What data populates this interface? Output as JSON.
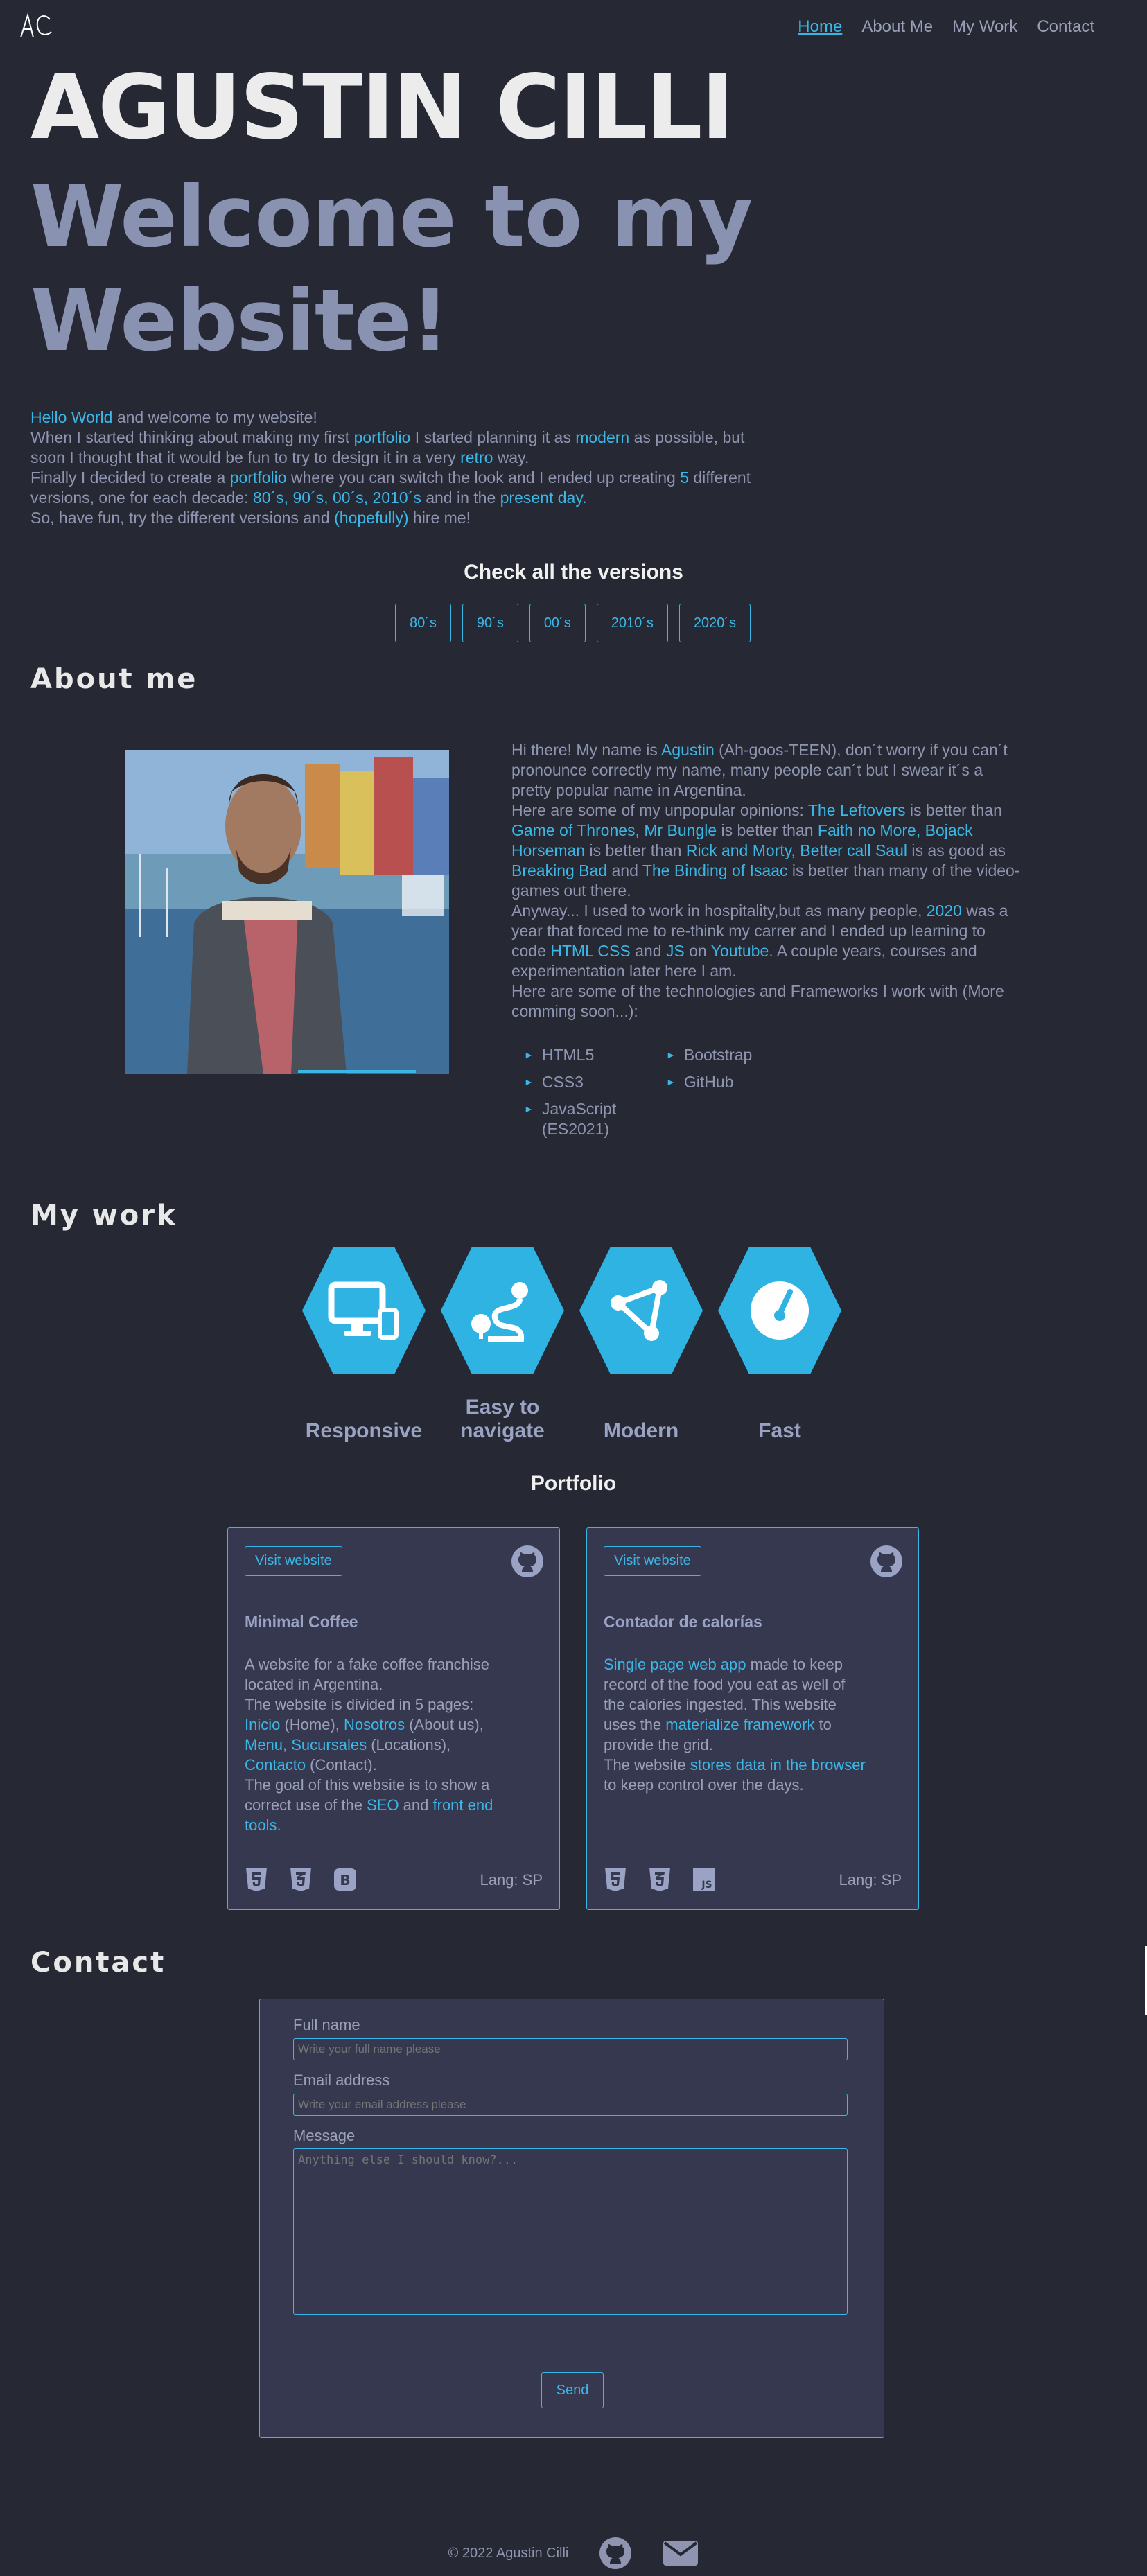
{
  "nav": {
    "logo_text": "AC",
    "items": [
      "Home",
      "About Me",
      "My Work",
      "Contact"
    ]
  },
  "hero": {
    "name": "AGUSTIN CILLI",
    "welcome": "Welcome to my Website!"
  },
  "intro": {
    "l1_a": "Hello World",
    "l1_b": " and welcome to my website!",
    "l2_a": "When I started thinking about making my first ",
    "l2_b": "portfolio",
    "l2_c": " I started planning it as ",
    "l2_d": "modern",
    "l2_e": " as possible, but soon I thought that it would be fun to try to design it in a very ",
    "l2_f": "retro",
    "l2_g": " way.",
    "l3_a": "Finally I decided to create a ",
    "l3_b": "portfolio",
    "l3_c": " where you can switch the look and I ended up creating ",
    "l3_d": "5",
    "l3_e": " different versions, one for each decade: ",
    "l3_f": "80´s, 90´s, 00´s, 2010´s",
    "l3_g": " and in the ",
    "l3_h": "present day.",
    "l4_a": "So, have fun, try the different versions and ",
    "l4_b": "(hopefully)",
    "l4_c": " hire me!"
  },
  "versions": {
    "title": "Check all the versions",
    "buttons": [
      "80´s",
      "90´s",
      "00´s",
      "2010´s",
      "2020´s"
    ]
  },
  "about": {
    "title": "About me",
    "p1_a": "Hi there! My name is ",
    "p1_b": "Agustin",
    "p1_c": " (Ah-goos-TEEN), don´t worry if you can´t pronounce correctly my name, many people can´t but I swear it´s a pretty popular name in Argentina.",
    "p2_a": "Here are some of my unpopular opinions: ",
    "p2_b": "The Leftovers",
    "p2_c": " is better than ",
    "p2_d": "Game of Thrones, Mr Bungle",
    "p2_e": " is better than ",
    "p2_f": "Faith no More, Bojack Horseman",
    "p2_g": " is better than ",
    "p2_h": "Rick and Morty, Better call Saul",
    "p2_i": " is as good as ",
    "p2_j": "Breaking Bad",
    "p2_k": " and ",
    "p2_l": "The Binding of Isaac",
    "p2_m": " is better than many of the video-games out there.",
    "p3_a": "Anyway... I used to work in hospitality,but as many people, ",
    "p3_b": "2020",
    "p3_c": " was a year that forced me to re-think my carrer and I ended up learning to code ",
    "p3_d": "HTML CSS",
    "p3_e": " and ",
    "p3_f": "JS",
    "p3_g": " on ",
    "p3_h": "Youtube",
    "p3_i": ". A couple years, courses and experimentation later here I am.",
    "p4": "Here are some of the technologies and Frameworks I work with (More comming soon...):",
    "tech": [
      "HTML5",
      "Bootstrap",
      "CSS3",
      "GitHub",
      "JavaScript (ES2021)"
    ]
  },
  "work": {
    "title": "My work",
    "features": [
      "Responsive",
      "Easy to navigate",
      "Modern",
      "Fast"
    ],
    "features_icons": [
      "devices-icon",
      "route-icon",
      "network-icon",
      "gauge-icon"
    ]
  },
  "portfolio": {
    "title": "Portfolio",
    "cards": [
      {
        "visit": "Visit website",
        "title": "Minimal Coffee",
        "d1": "A website for a fake coffee franchise located in Argentina.",
        "d2": "The website is divided in 5 pages:",
        "d3_a": "Inicio",
        "d3_b": " (Home), ",
        "d3_c": "Nosotros",
        "d3_d": " (About us),",
        "d4_a": "Menu, Sucursales",
        "d4_b": " (Locations),",
        "d5_a": "Contacto",
        "d5_b": " (Contact).",
        "d6_a": "The goal of this website is to show a correct use of the ",
        "d6_b": "SEO",
        "d6_c": " and ",
        "d6_d": "front end tools.",
        "lang": "Lang: SP",
        "icons": [
          "html5-icon",
          "css3-icon",
          "bootstrap-icon"
        ]
      },
      {
        "visit": "Visit website",
        "title": "Contador de calorías",
        "d1_a": "Single page web app",
        "d1_b": " made to keep record of the food you eat as well of the calories ingested. This website uses the ",
        "d1_c": "materialize framework",
        "d1_d": " to provide the grid.",
        "d2_a": "The website ",
        "d2_b": "stores data in the browser",
        "d2_c": " to keep control over the days.",
        "lang": "Lang: SP",
        "icons": [
          "html5-icon",
          "css3-icon",
          "js-icon"
        ]
      }
    ]
  },
  "contact": {
    "title": "Contact",
    "name_label": "Full name",
    "name_placeholder": "Write your full name please",
    "email_label": "Email address",
    "email_placeholder": "Write your email address please",
    "message_label": "Message",
    "message_placeholder": "Anything else I should know?...",
    "send": "Send"
  },
  "footer": {
    "copyright": "© 2022 Agustin Cilli"
  },
  "colors": {
    "background": "#262833",
    "accent": "#3ab7e6",
    "card": "#363850",
    "heading": "#8a92b2"
  }
}
